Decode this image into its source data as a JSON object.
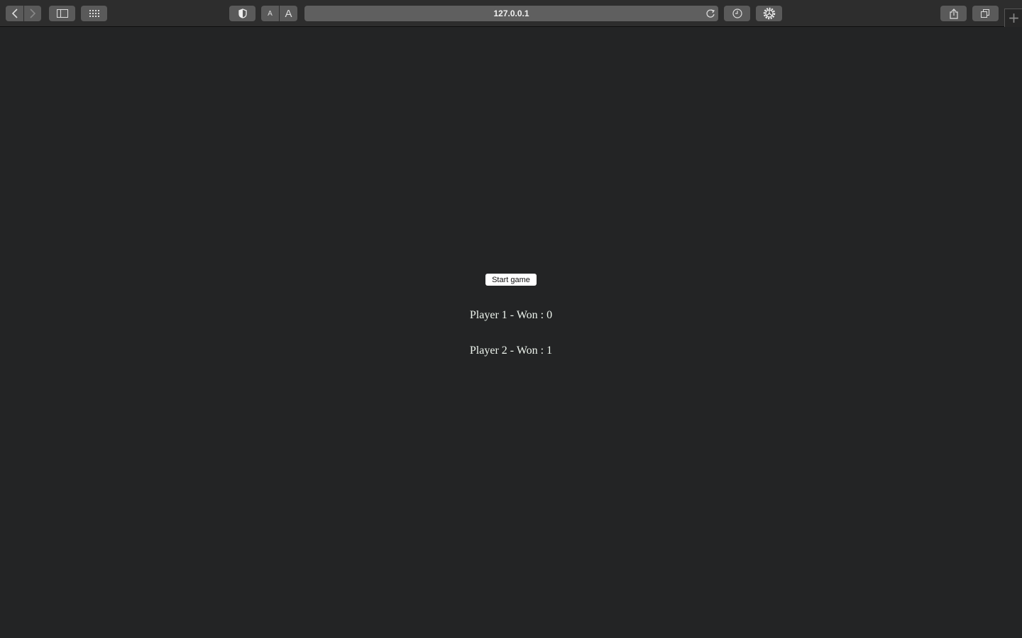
{
  "browser": {
    "url": "127.0.0.1",
    "icons": [
      "chevron-left-icon",
      "chevron-right-icon",
      "sidebar-icon",
      "grid-icon",
      "shield-icon",
      "text-smaller-icon",
      "text-larger-icon",
      "reload-icon",
      "clock-icon",
      "gear-icon",
      "share-icon",
      "tabs-icon",
      "plus-icon"
    ],
    "text_small": "A",
    "text_large": "A",
    "new_tab": "+"
  },
  "game": {
    "start_label": "Start game",
    "scores": [
      "Player 1 - Won : 0",
      "Player 2 - Won : 1"
    ]
  }
}
